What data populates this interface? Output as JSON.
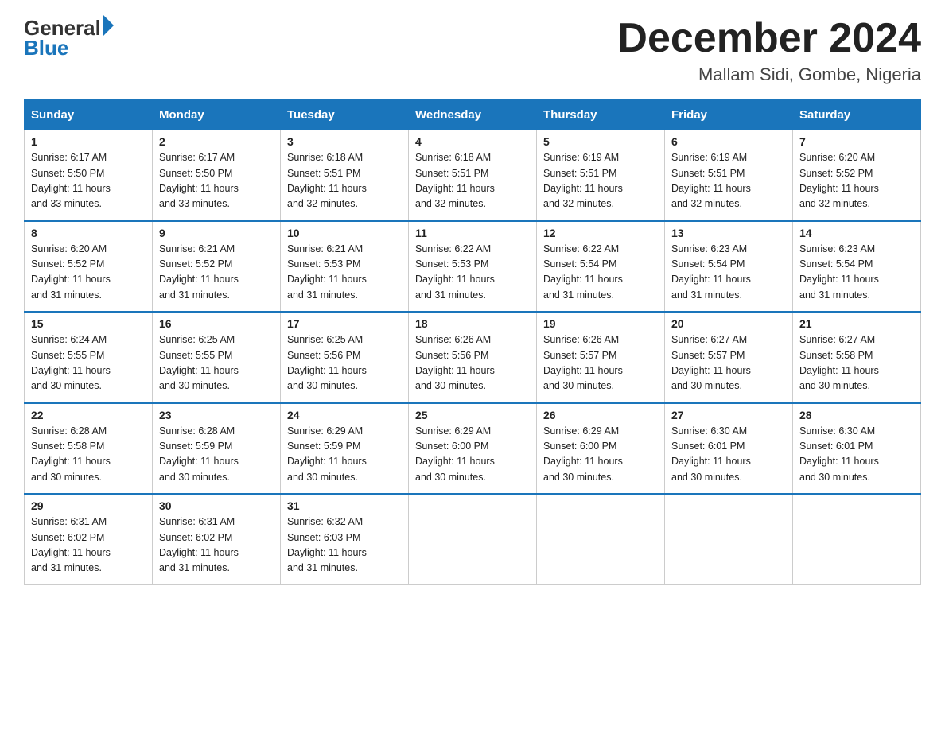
{
  "logo": {
    "text_general": "General",
    "text_blue": "Blue"
  },
  "title": "December 2024",
  "subtitle": "Mallam Sidi, Gombe, Nigeria",
  "weekdays": [
    "Sunday",
    "Monday",
    "Tuesday",
    "Wednesday",
    "Thursday",
    "Friday",
    "Saturday"
  ],
  "weeks": [
    [
      {
        "day": "1",
        "info": "Sunrise: 6:17 AM\nSunset: 5:50 PM\nDaylight: 11 hours\nand 33 minutes."
      },
      {
        "day": "2",
        "info": "Sunrise: 6:17 AM\nSunset: 5:50 PM\nDaylight: 11 hours\nand 33 minutes."
      },
      {
        "day": "3",
        "info": "Sunrise: 6:18 AM\nSunset: 5:51 PM\nDaylight: 11 hours\nand 32 minutes."
      },
      {
        "day": "4",
        "info": "Sunrise: 6:18 AM\nSunset: 5:51 PM\nDaylight: 11 hours\nand 32 minutes."
      },
      {
        "day": "5",
        "info": "Sunrise: 6:19 AM\nSunset: 5:51 PM\nDaylight: 11 hours\nand 32 minutes."
      },
      {
        "day": "6",
        "info": "Sunrise: 6:19 AM\nSunset: 5:51 PM\nDaylight: 11 hours\nand 32 minutes."
      },
      {
        "day": "7",
        "info": "Sunrise: 6:20 AM\nSunset: 5:52 PM\nDaylight: 11 hours\nand 32 minutes."
      }
    ],
    [
      {
        "day": "8",
        "info": "Sunrise: 6:20 AM\nSunset: 5:52 PM\nDaylight: 11 hours\nand 31 minutes."
      },
      {
        "day": "9",
        "info": "Sunrise: 6:21 AM\nSunset: 5:52 PM\nDaylight: 11 hours\nand 31 minutes."
      },
      {
        "day": "10",
        "info": "Sunrise: 6:21 AM\nSunset: 5:53 PM\nDaylight: 11 hours\nand 31 minutes."
      },
      {
        "day": "11",
        "info": "Sunrise: 6:22 AM\nSunset: 5:53 PM\nDaylight: 11 hours\nand 31 minutes."
      },
      {
        "day": "12",
        "info": "Sunrise: 6:22 AM\nSunset: 5:54 PM\nDaylight: 11 hours\nand 31 minutes."
      },
      {
        "day": "13",
        "info": "Sunrise: 6:23 AM\nSunset: 5:54 PM\nDaylight: 11 hours\nand 31 minutes."
      },
      {
        "day": "14",
        "info": "Sunrise: 6:23 AM\nSunset: 5:54 PM\nDaylight: 11 hours\nand 31 minutes."
      }
    ],
    [
      {
        "day": "15",
        "info": "Sunrise: 6:24 AM\nSunset: 5:55 PM\nDaylight: 11 hours\nand 30 minutes."
      },
      {
        "day": "16",
        "info": "Sunrise: 6:25 AM\nSunset: 5:55 PM\nDaylight: 11 hours\nand 30 minutes."
      },
      {
        "day": "17",
        "info": "Sunrise: 6:25 AM\nSunset: 5:56 PM\nDaylight: 11 hours\nand 30 minutes."
      },
      {
        "day": "18",
        "info": "Sunrise: 6:26 AM\nSunset: 5:56 PM\nDaylight: 11 hours\nand 30 minutes."
      },
      {
        "day": "19",
        "info": "Sunrise: 6:26 AM\nSunset: 5:57 PM\nDaylight: 11 hours\nand 30 minutes."
      },
      {
        "day": "20",
        "info": "Sunrise: 6:27 AM\nSunset: 5:57 PM\nDaylight: 11 hours\nand 30 minutes."
      },
      {
        "day": "21",
        "info": "Sunrise: 6:27 AM\nSunset: 5:58 PM\nDaylight: 11 hours\nand 30 minutes."
      }
    ],
    [
      {
        "day": "22",
        "info": "Sunrise: 6:28 AM\nSunset: 5:58 PM\nDaylight: 11 hours\nand 30 minutes."
      },
      {
        "day": "23",
        "info": "Sunrise: 6:28 AM\nSunset: 5:59 PM\nDaylight: 11 hours\nand 30 minutes."
      },
      {
        "day": "24",
        "info": "Sunrise: 6:29 AM\nSunset: 5:59 PM\nDaylight: 11 hours\nand 30 minutes."
      },
      {
        "day": "25",
        "info": "Sunrise: 6:29 AM\nSunset: 6:00 PM\nDaylight: 11 hours\nand 30 minutes."
      },
      {
        "day": "26",
        "info": "Sunrise: 6:29 AM\nSunset: 6:00 PM\nDaylight: 11 hours\nand 30 minutes."
      },
      {
        "day": "27",
        "info": "Sunrise: 6:30 AM\nSunset: 6:01 PM\nDaylight: 11 hours\nand 30 minutes."
      },
      {
        "day": "28",
        "info": "Sunrise: 6:30 AM\nSunset: 6:01 PM\nDaylight: 11 hours\nand 30 minutes."
      }
    ],
    [
      {
        "day": "29",
        "info": "Sunrise: 6:31 AM\nSunset: 6:02 PM\nDaylight: 11 hours\nand 31 minutes."
      },
      {
        "day": "30",
        "info": "Sunrise: 6:31 AM\nSunset: 6:02 PM\nDaylight: 11 hours\nand 31 minutes."
      },
      {
        "day": "31",
        "info": "Sunrise: 6:32 AM\nSunset: 6:03 PM\nDaylight: 11 hours\nand 31 minutes."
      },
      null,
      null,
      null,
      null
    ]
  ]
}
